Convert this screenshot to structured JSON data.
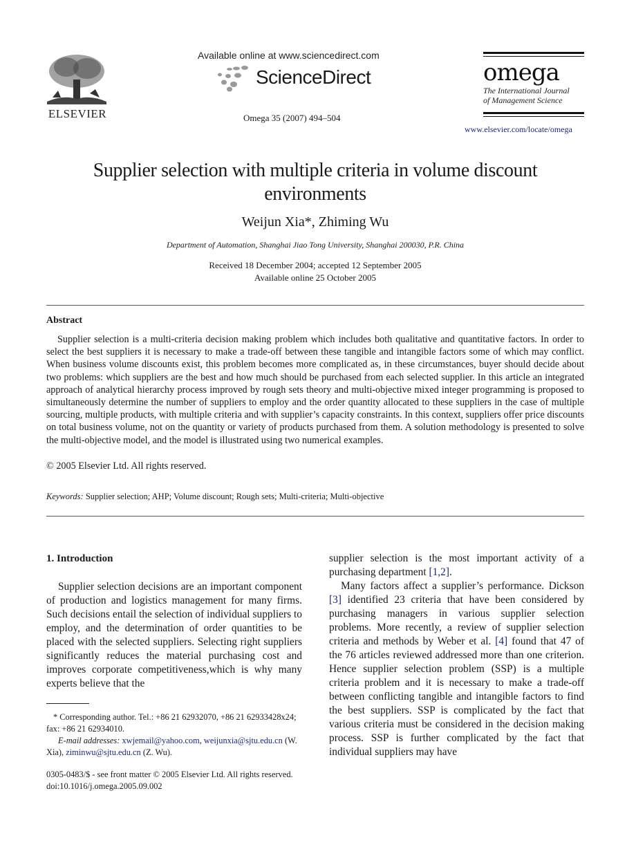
{
  "header": {
    "publisher": "ELSEVIER",
    "sd_available": "Available online at www.sciencedirect.com",
    "sd_name": "ScienceDirect",
    "journal_ref": "Omega 35 (2007) 494–504",
    "journal_logo": "omega",
    "journal_subtitle_1": "The International Journal",
    "journal_subtitle_2": "of Management Science",
    "journal_url": "www.elsevier.com/locate/omega"
  },
  "article": {
    "title": "Supplier selection with multiple criteria in volume discount environments",
    "authors": "Weijun Xia*, Zhiming Wu",
    "affiliation": "Department of Automation, Shanghai Jiao Tong University, Shanghai 200030, P.R. China",
    "received": "Received 18 December 2004; accepted 12 September 2005",
    "available_online": "Available online 25 October 2005"
  },
  "abstract": {
    "heading": "Abstract",
    "text": "Supplier selection is a multi-criteria decision making problem which includes both qualitative and quantitative factors. In order to select the best suppliers it is necessary to make a trade-off between these tangible and intangible factors some of which may conflict. When business volume discounts exist, this problem becomes more complicated as, in these circumstances, buyer should decide about two problems: which suppliers are the best and how much should be purchased from each selected supplier. In this article an integrated approach of analytical hierarchy process improved by rough sets theory and multi-objective mixed integer programming is proposed to simultaneously determine the number of suppliers to employ and the order quantity allocated to these suppliers in the case of multiple sourcing, multiple products, with multiple criteria and with supplier’s capacity constraints. In this context, suppliers offer price discounts on total business volume, not on the quantity or variety of products purchased from them. A solution methodology is presented to solve the multi-objective model, and the model is illustrated using two numerical examples.",
    "copyright": "© 2005 Elsevier Ltd. All rights reserved."
  },
  "keywords": {
    "label": "Keywords:",
    "list": "Supplier selection; AHP; Volume discount; Rough sets; Multi-criteria; Multi-objective"
  },
  "introduction": {
    "heading": "1.  Introduction",
    "left_para": "Supplier selection decisions are an important compo­nent of production and logistics management for many firms. Such decisions entail the selection of individual suppliers to employ, and the determination of order quantities to be placed with the selected suppliers. Se­lecting right suppliers significantly reduces the material purchasing cost and improves corporate competi­tiveness,which is why many experts believe that the",
    "right_cont_a": "supplier selection is the most important activity of a purchasing department ",
    "right_cont_ref": "[1,2]",
    "right_cont_b": ".",
    "para2_a": "Many factors affect a supplier’s performance. Dick­son ",
    "para2_ref1": "[3]",
    "para2_b": " identified 23 criteria that have been considered by purchasing managers in various supplier selection problems. More recently, a review of supplier selection criteria and methods by Weber et al. ",
    "para2_ref2": "[4]",
    "para2_c": " found that 47 of the 76 articles reviewed addressed more than one criterion. Hence supplier selection problem (SSP) is a multiple criteria problem and it is necessary to make a trade-off between conflicting tangible and intangible factors to find the best suppliers. SSP is complicated by the fact that various criteria must be considered in the decision making process. SSP is further compli­cated by the fact that individual suppliers may have"
  },
  "footnote": {
    "corresponding": "* Corresponding author. Tel.: +86 21 62932070, +86 21 62933428x24; fax: +86 21 62934010.",
    "email_label": "E-mail addresses:",
    "email1": "xwjemail@yahoo.com",
    "email2": "weijunxia@sjtu.edu.cn",
    "email2_owner": "(W. Xia),",
    "email3": "ziminwu@sjtu.edu.cn",
    "email3_owner": "(Z. Wu)."
  },
  "front_matter": {
    "issn": "0305-0483/$ - see front matter © 2005 Elsevier Ltd. All rights reserved.",
    "doi": "doi:10.1016/j.omega.2005.09.002"
  },
  "colors": {
    "link": "#23237a",
    "text": "#1a1a1a"
  }
}
